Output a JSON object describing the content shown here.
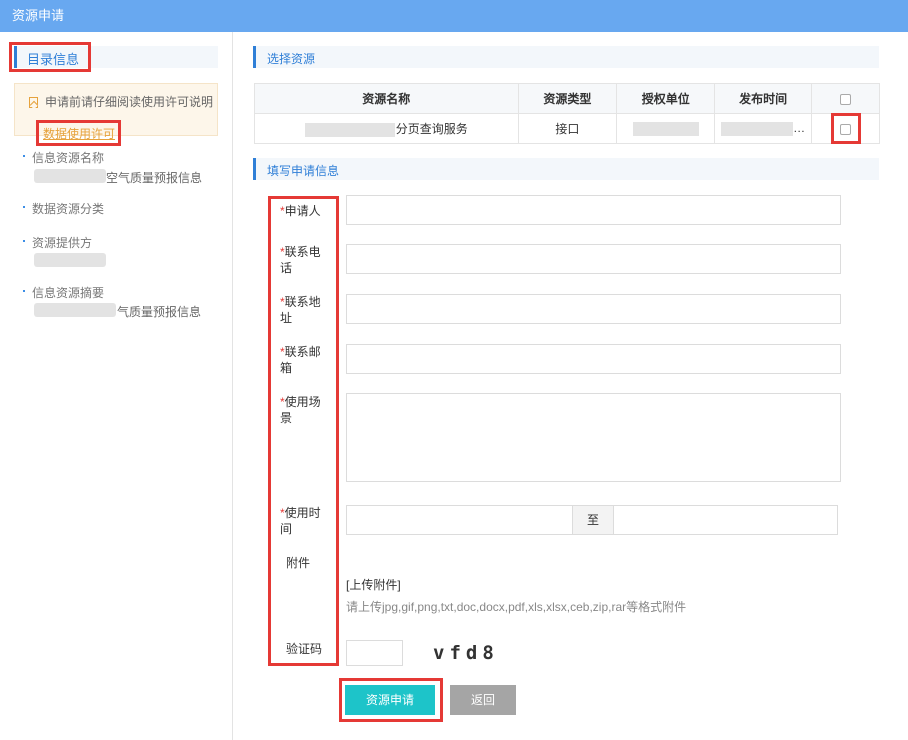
{
  "window": {
    "title": "资源申请"
  },
  "sidebar": {
    "heading": "目录信息",
    "notice_text": "申请前请仔细阅读使用许可说明",
    "notice_link": "数据使用许可",
    "fields": [
      {
        "label": "信息资源名称",
        "value": "空气质量预报信息"
      },
      {
        "label": "数据资源分类",
        "value": ""
      },
      {
        "label": "资源提供方",
        "value": ""
      },
      {
        "label": "信息资源摘要",
        "value": "气质量预报信息"
      }
    ]
  },
  "resource_section": {
    "title": "选择资源",
    "columns": [
      "资源名称",
      "资源类型",
      "授权单位",
      "发布时间"
    ],
    "rows": [
      {
        "name": "分页查询服务",
        "type": "接口",
        "unit": "",
        "time": "…",
        "checked": false
      }
    ]
  },
  "form_section": {
    "title": "填写申请信息",
    "fields": [
      {
        "label": "申请人",
        "required": true,
        "value": ""
      },
      {
        "label": "联系电话",
        "required": true,
        "value": ""
      },
      {
        "label": "联系地址",
        "required": true,
        "value": ""
      },
      {
        "label": "联系邮箱",
        "required": true,
        "value": ""
      },
      {
        "label": "使用场景",
        "required": true,
        "value": ""
      },
      {
        "label": "使用时间",
        "required": true,
        "value": ""
      }
    ],
    "date_separator": "至",
    "attachment": {
      "label": "附件",
      "upload_link": "[上传附件]",
      "hint": "请上传jpg,gif,png,txt,doc,docx,pdf,xls,xlsx,ceb,zip,rar等格式附件"
    },
    "captcha": {
      "label": "验证码",
      "value": "",
      "image_text": "vfd8"
    }
  },
  "buttons": {
    "submit": "资源申请",
    "back": "返回"
  },
  "colors": {
    "titlebar": "#68a8f0",
    "accent": "#2f7fd7",
    "submit": "#1dc4c9",
    "back": "#a5a5a5",
    "highlight": "#e53935",
    "link": "#e6a23c"
  }
}
